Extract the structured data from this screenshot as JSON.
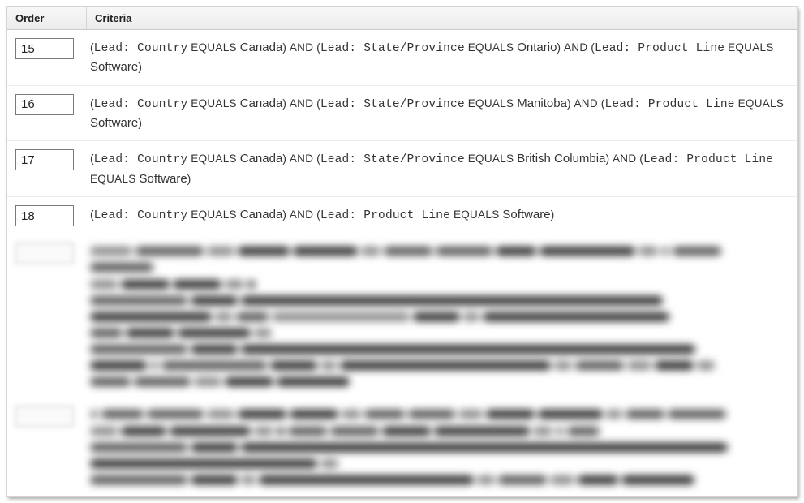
{
  "headers": {
    "order": "Order",
    "criteria": "Criteria"
  },
  "rows": [
    {
      "order": "15",
      "criteria_html": "<span class='paren'>(</span><span class='fld'>Lead: Country</span> <span class='op-kw'>EQUALS</span> <span class='val'>Canada</span><span class='paren'>)</span> <span class='op-kw'>AND</span> <span class='paren'>(</span><span class='fld'>Lead: State/Province</span> <span class='op-kw'>EQUALS</span> <span class='val'>Ontario</span><span class='paren'>)</span> <span class='op-kw'>AND</span> <span class='paren'>(</span><span class='fld'>Lead: Product Line</span> <span class='op-kw'>EQUALS</span> <span class='val'>Software</span><span class='paren'>)</span>",
      "criteria_data": [
        {
          "field": "Lead: Country",
          "op": "EQUALS",
          "value": "Canada"
        },
        {
          "field": "Lead: State/Province",
          "op": "EQUALS",
          "value": "Ontario"
        },
        {
          "field": "Lead: Product Line",
          "op": "EQUALS",
          "value": "Software"
        }
      ]
    },
    {
      "order": "16",
      "criteria_html": "<span class='paren'>(</span><span class='fld'>Lead: Country</span> <span class='op-kw'>EQUALS</span> <span class='val'>Canada</span><span class='paren'>)</span> <span class='op-kw'>AND</span> <span class='paren'>(</span><span class='fld'>Lead: State/Province</span> <span class='op-kw'>EQUALS</span> <span class='val'>Manitoba</span><span class='paren'>)</span> <span class='op-kw'>AND</span> <span class='paren'>(</span><span class='fld'>Lead: Product Line</span> <span class='op-kw'>EQUALS</span> <span class='val'>Software</span><span class='paren'>)</span>",
      "criteria_data": [
        {
          "field": "Lead: Country",
          "op": "EQUALS",
          "value": "Canada"
        },
        {
          "field": "Lead: State/Province",
          "op": "EQUALS",
          "value": "Manitoba"
        },
        {
          "field": "Lead: Product Line",
          "op": "EQUALS",
          "value": "Software"
        }
      ]
    },
    {
      "order": "17",
      "criteria_html": "<span class='paren'>(</span><span class='fld'>Lead: Country</span> <span class='op-kw'>EQUALS</span> <span class='val'>Canada</span><span class='paren'>)</span> <span class='op-kw'>AND</span> <span class='paren'>(</span><span class='fld'>Lead: State/Province</span> <span class='op-kw'>EQUALS</span> <span class='val'>British Columbia</span><span class='paren'>)</span> <span class='op-kw'>AND</span> <span class='paren'>(</span><span class='fld'>Lead: Product Line</span> <span class='op-kw'>EQUALS</span> <span class='val'>Software</span><span class='paren'>)</span>",
      "criteria_data": [
        {
          "field": "Lead: Country",
          "op": "EQUALS",
          "value": "Canada"
        },
        {
          "field": "Lead: State/Province",
          "op": "EQUALS",
          "value": "British Columbia"
        },
        {
          "field": "Lead: Product Line",
          "op": "EQUALS",
          "value": "Software"
        }
      ]
    },
    {
      "order": "18",
      "criteria_html": "<span class='paren'>(</span><span class='fld'>Lead: Country</span> <span class='op-kw'>EQUALS</span> <span class='val'>Canada</span><span class='paren'>)</span> <span class='op-kw'>AND</span> <span class='paren'>(</span><span class='fld'>Lead: Product Line</span> <span class='op-kw'>EQUALS</span> <span class='val'>Software</span><span class='paren'>)</span>",
      "criteria_data": [
        {
          "field": "Lead: Country",
          "op": "EQUALS",
          "value": "Canada"
        },
        {
          "field": "Lead: Product Line",
          "op": "EQUALS",
          "value": "Software"
        }
      ]
    }
  ]
}
